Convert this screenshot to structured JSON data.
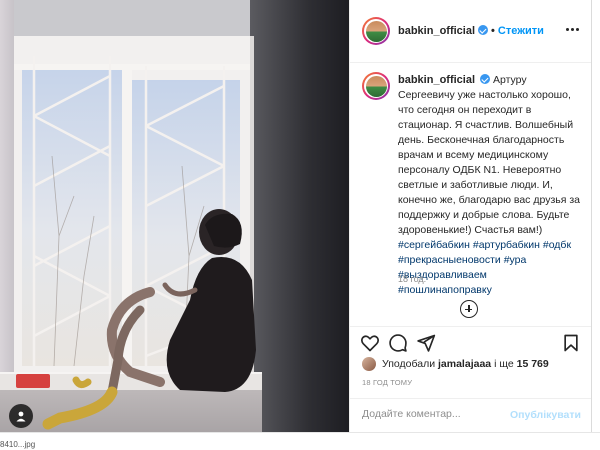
{
  "post": {
    "username": "babkin_official",
    "separator": "•",
    "follow_label": "Стежити",
    "caption": "Артуру Сергеевичу уже настолько хорошо, что сегодня он переходит в стационар. Я счастлив. Волшебный день. Бесконечная благодарность врачам и всему медицинскому персоналу ОДБК N1. Невероятно светлые и заботливые люди. И, конечно же, благодарю вас друзья за поддержку и добрые слова. Будьте здоровенькие!) Счастья вам!)",
    "hashtags": "#сергейбабкин #артурбабкин #одбк #прекрасныеновости #ура #выздоравливаем #пошлинапоправку",
    "caption_time": "18 год.",
    "likes_prefix": "Уподобали",
    "likes_user": "jamalajaaa",
    "likes_mid": "і ще",
    "likes_count": "15 769",
    "post_date": "18 ГОД ТОМУ",
    "comment_placeholder": "Додайте коментар...",
    "post_button": "Опублікувати"
  },
  "footer": {
    "filename": "8410...jpg"
  },
  "icons": {
    "like": "heart-icon",
    "comment": "comment-icon",
    "share": "send-icon",
    "save": "bookmark-icon",
    "tagged": "user-tag-icon",
    "more": "more-options-icon",
    "load_more": "plus-circle-icon"
  },
  "colors": {
    "accent": "#0095f6",
    "verified": "#3897f0",
    "hashtag": "#00376b",
    "muted": "#8e8e8e",
    "post_button_disabled": "#b2dffc"
  }
}
